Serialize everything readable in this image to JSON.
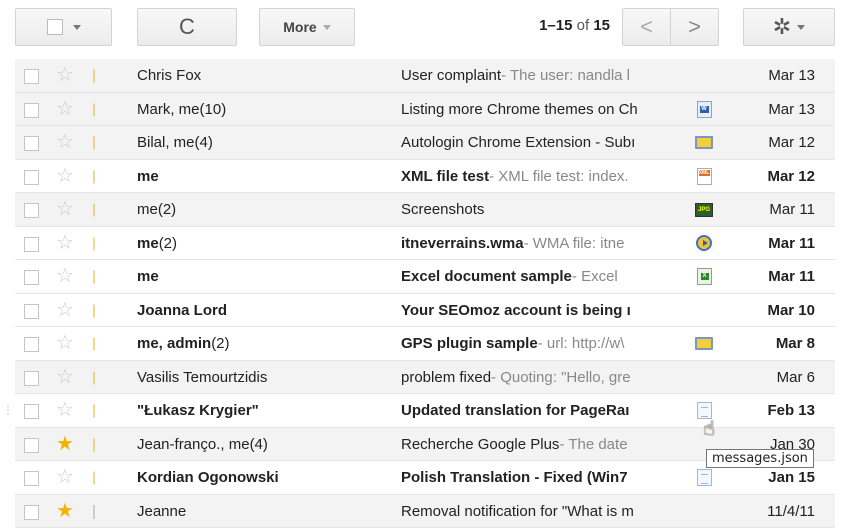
{
  "toolbar": {
    "refresh_glyph": "C",
    "more_label": "More",
    "count_range": "1–15",
    "count_of": " of ",
    "count_total": "15",
    "prev_glyph": "<",
    "next_glyph": ">",
    "settings_glyph": "✲"
  },
  "rows": [
    {
      "sender": "Chris Fox",
      "sender_count": "",
      "subject": "User complaint",
      "snippet": " - The user: nandla l",
      "attachment": "",
      "date": "Mar 13",
      "unread": false,
      "starred": false
    },
    {
      "sender": "Mark, me",
      "sender_count": " (10)",
      "subject": "Listing more Chrome themes on Ch",
      "snippet": "",
      "attachment": "doc-icon",
      "date": "Mar 13",
      "unread": false,
      "starred": false
    },
    {
      "sender": "Bilal, me",
      "sender_count": " (4)",
      "subject": "Autologin Chrome Extension - Subı",
      "snippet": "",
      "attachment": "screen-icon",
      "date": "Mar 12",
      "unread": false,
      "starred": false
    },
    {
      "sender": "me",
      "sender_count": "",
      "subject": "XML file test",
      "snippet": " - XML file test: index.",
      "attachment": "xml-icon",
      "date": "Mar 12",
      "unread": true,
      "starred": false
    },
    {
      "sender": "me",
      "sender_count": " (2)",
      "subject": "Screenshots",
      "snippet": "",
      "attachment": "jpg-icon",
      "date": "Mar 11",
      "unread": false,
      "starred": false
    },
    {
      "sender": "me",
      "sender_count": " (2)",
      "subject": "itneverrains.wma",
      "snippet": " - WMA file: itne",
      "attachment": "media-icon",
      "date": "Mar 11",
      "unread": true,
      "starred": false
    },
    {
      "sender": "me",
      "sender_count": "",
      "subject": "Excel document sample",
      "snippet": " - Excel",
      "attachment": "xls-icon",
      "date": "Mar 11",
      "unread": true,
      "starred": false
    },
    {
      "sender": "Joanna Lord",
      "sender_count": "",
      "subject": "Your SEOmoz account is being ı",
      "snippet": "",
      "attachment": "",
      "date": "Mar 10",
      "unread": true,
      "starred": false
    },
    {
      "sender": "me, admin",
      "sender_count": " (2)",
      "subject": "GPS plugin sample",
      "snippet": " - url: http://w\\",
      "attachment": "screen-icon",
      "date": "Mar 8",
      "unread": true,
      "starred": false
    },
    {
      "sender": "Vasilis Temourtzidis",
      "sender_count": "",
      "subject": "problem fixed",
      "snippet": " - Quoting: \"Hello, gre",
      "attachment": "",
      "date": "Mar 6",
      "unread": false,
      "starred": false
    },
    {
      "sender": "\"Łukasz Krygier\"",
      "sender_count": "",
      "subject": "Updated translation for PageRaı",
      "snippet": "",
      "attachment": "txt-icon",
      "date": "Feb 13",
      "unread": true,
      "starred": false
    },
    {
      "sender": "Jean-franço., me",
      "sender_count": " (4)",
      "subject": "Recherche Google Plus",
      "snippet": " - The date",
      "attachment": "",
      "date": "Jan 30",
      "unread": false,
      "starred": true
    },
    {
      "sender": "Kordian Ogonowski",
      "sender_count": "",
      "subject": "Polish Translation - Fixed (Win7",
      "snippet": "",
      "attachment": "txt-icon",
      "date": "Jan 15",
      "unread": true,
      "starred": false
    },
    {
      "sender": "Jeanne",
      "sender_count": "",
      "subject": "Removal notification for \"What is m",
      "snippet": "",
      "attachment": "",
      "date": "11/4/11",
      "unread": false,
      "starred": true
    }
  ],
  "tooltip": "messages.json",
  "colors": {
    "label": "#f7d04b",
    "star_on": "#f0b400",
    "read_row": "#f3f3f3"
  }
}
